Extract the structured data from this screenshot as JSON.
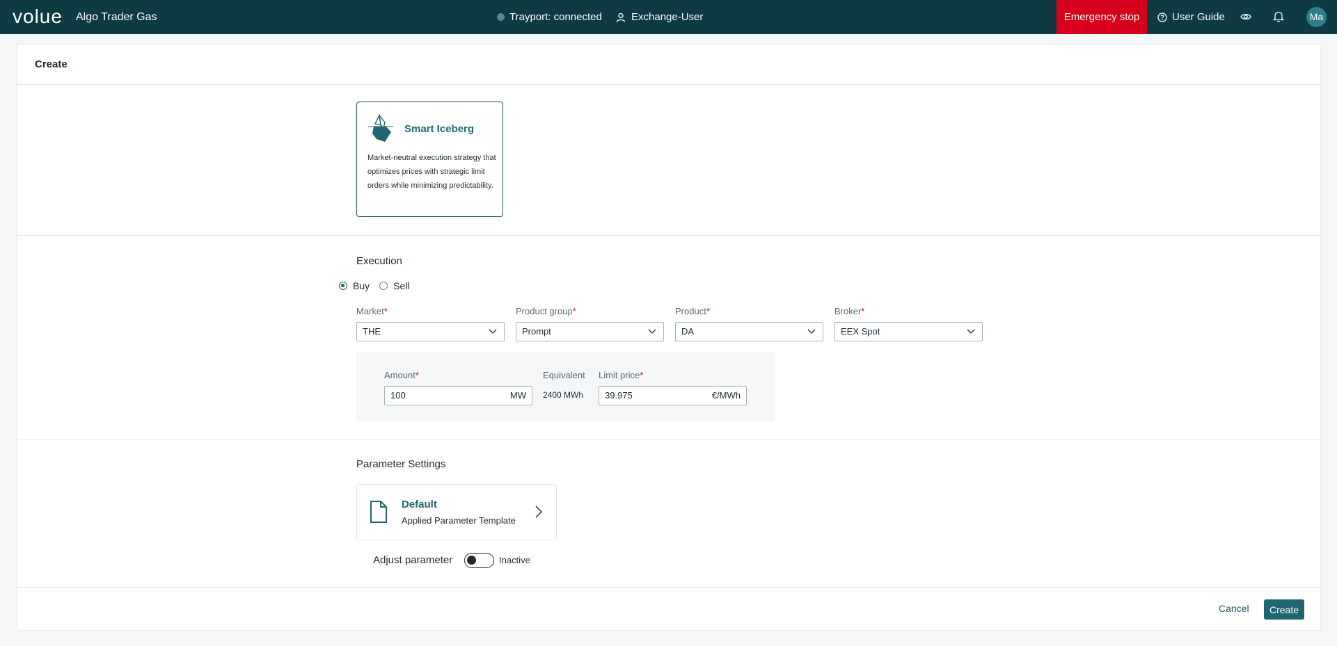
{
  "app": {
    "logo": "volue",
    "name": "Algo Trader Gas"
  },
  "header": {
    "status": "Trayport: connected",
    "user": "Exchange-User",
    "emergency_stop": "Emergency stop",
    "user_guide": "User Guide",
    "avatar_initials": "Ma",
    "status_color": "#4d8a95",
    "emergency_color": "#d6001c"
  },
  "page": {
    "title": "Create"
  },
  "strategy": {
    "name": "Smart Iceberg",
    "description": "Market-neutral execution strategy that optimizes prices with strategic limit orders while minimizing predictability.",
    "icon": "iceberg-icon"
  },
  "execution": {
    "title": "Execution",
    "side_options": [
      {
        "label": "Buy",
        "selected": true
      },
      {
        "label": "Sell",
        "selected": false
      }
    ],
    "fields": {
      "market": {
        "label": "Market",
        "required_mark": "*",
        "value": "THE"
      },
      "product_group": {
        "label": "Product group",
        "required_mark": "*",
        "value": "Prompt"
      },
      "product": {
        "label": "Product",
        "required_mark": "*",
        "value": "DA"
      },
      "broker": {
        "label": "Broker",
        "required_mark": "*",
        "value": "EEX Spot"
      }
    },
    "amount": {
      "label": "Amount",
      "required_mark": "*",
      "value": "100",
      "unit": "MW"
    },
    "equivalent": {
      "label": "Equivalent",
      "value": "2400 MWh"
    },
    "limit_price": {
      "label": "Limit price",
      "required_mark": "*",
      "value": "39.975",
      "unit": "€/MWh"
    }
  },
  "parameters": {
    "title": "Parameter Settings",
    "template_name": "Default",
    "template_subtitle": "Applied Parameter Template",
    "adjust_label": "Adjust parameter",
    "toggle_state": "Inactive"
  },
  "footer": {
    "cancel": "Cancel",
    "create": "Create"
  },
  "colors": {
    "accent": "#1f6670",
    "topbar": "#0e3a42"
  }
}
